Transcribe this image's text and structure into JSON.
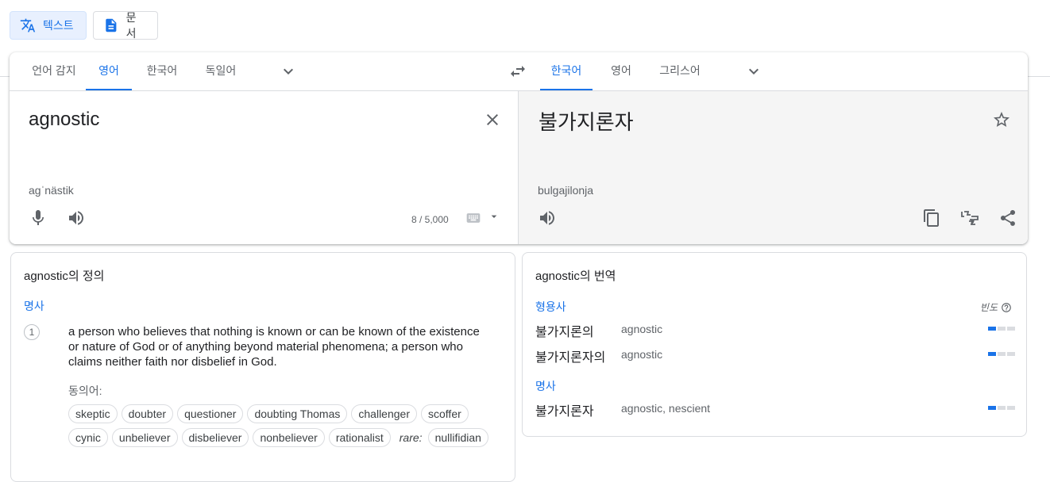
{
  "modes": {
    "text": "텍스트",
    "documents": "문서"
  },
  "source_langs": [
    "언어 감지",
    "영어",
    "한국어",
    "독일어"
  ],
  "target_langs": [
    "한국어",
    "영어",
    "그리스어"
  ],
  "source": {
    "text": "agnostic",
    "phonetic": "agˈnästik",
    "counter": "8 / 5,000"
  },
  "target": {
    "text": "불가지론자",
    "romanization": "bulgajilonja"
  },
  "definitions": {
    "title": "agnostic의 정의",
    "pos": "명사",
    "number": "1",
    "text": "a person who believes that nothing is known or can be known of the existence or nature of God or of anything beyond material phenomena; a person who claims neither faith nor disbelief in God.",
    "synonyms_label": "동의어:",
    "synonyms_row1": [
      "skeptic",
      "doubter",
      "questioner",
      "doubting Thomas",
      "challenger",
      "scoffer"
    ],
    "synonyms_row2": [
      "cynic",
      "unbeliever",
      "disbeliever",
      "nonbeliever",
      "rationalist"
    ],
    "rare_label": "rare:",
    "rare_synonyms": [
      "nullifidian"
    ]
  },
  "translations": {
    "title": "agnostic의 번역",
    "frequency_label": "빈도",
    "groups": [
      {
        "pos": "형용사",
        "rows": [
          {
            "word": "불가지론의",
            "back": "agnostic",
            "freq": 1
          },
          {
            "word": "불가지론자의",
            "back": "agnostic",
            "freq": 1
          }
        ]
      },
      {
        "pos": "명사",
        "rows": [
          {
            "word": "불가지론자",
            "back": "agnostic, nescient",
            "freq": 1
          }
        ]
      }
    ]
  },
  "colors": {
    "accent": "#1a73e8",
    "active_bg": "#e8f0fe",
    "target_bg": "#f5f5f5"
  }
}
